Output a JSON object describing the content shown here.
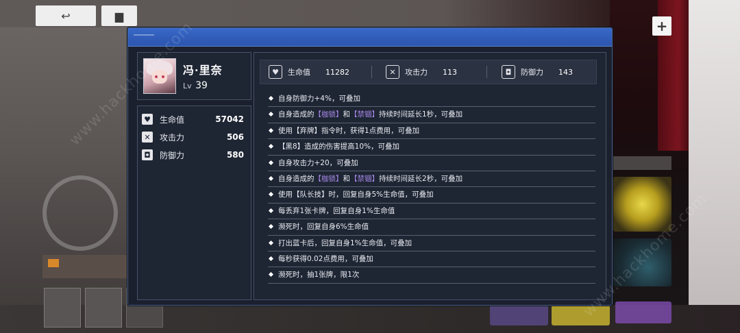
{
  "character": {
    "name": "冯·里奈",
    "level_prefix": "Lv",
    "level": "39"
  },
  "stats": [
    {
      "icon": "heart-icon",
      "glyph": "♥",
      "label": "生命值",
      "value": "57042"
    },
    {
      "icon": "sword-icon",
      "glyph": "✕",
      "label": "攻击力",
      "value": "506"
    },
    {
      "icon": "shield-icon",
      "glyph": "◘",
      "label": "防御力",
      "value": "580"
    }
  ],
  "summary": [
    {
      "icon": "heart-icon",
      "glyph": "♥",
      "label": "生命值",
      "value": "11282"
    },
    {
      "icon": "sword-icon",
      "glyph": "✕",
      "label": "攻击力",
      "value": "113"
    },
    {
      "icon": "shield-icon",
      "glyph": "◘",
      "label": "防御力",
      "value": "143"
    }
  ],
  "effects": [
    {
      "parts": [
        {
          "t": "自身防御力+4%，可叠加"
        }
      ]
    },
    {
      "parts": [
        {
          "t": "自身造成的"
        },
        {
          "t": "【枷锁】",
          "hl": true
        },
        {
          "t": "和"
        },
        {
          "t": "【禁锢】",
          "hl": true
        },
        {
          "t": "持续时间延长1秒，可叠加"
        }
      ]
    },
    {
      "parts": [
        {
          "t": "使用【弃牌】指令时，获得1点费用，可叠加"
        }
      ]
    },
    {
      "parts": [
        {
          "t": "【黑8】造成的伤害提高10%，可叠加"
        }
      ]
    },
    {
      "parts": [
        {
          "t": "自身攻击力+20，可叠加"
        }
      ]
    },
    {
      "parts": [
        {
          "t": "自身造成的"
        },
        {
          "t": "【枷锁】",
          "hl": true
        },
        {
          "t": "和"
        },
        {
          "t": "【禁锢】",
          "hl": true
        },
        {
          "t": "持续时间延长2秒，可叠加"
        }
      ]
    },
    {
      "parts": [
        {
          "t": "使用【队长技】时，回复自身5%生命值，可叠加"
        }
      ]
    },
    {
      "parts": [
        {
          "t": "每丢弃1张卡牌，回复自身1%生命值"
        }
      ]
    },
    {
      "parts": [
        {
          "t": "濒死时，回复自身6%生命值"
        }
      ]
    },
    {
      "parts": [
        {
          "t": "打出蓝卡后，回复自身1%生命值，可叠加"
        }
      ]
    },
    {
      "parts": [
        {
          "t": "每秒获得0.02点费用，可叠加"
        }
      ]
    },
    {
      "parts": [
        {
          "t": "濒死时，抽1张牌，限1次"
        }
      ]
    }
  ],
  "colors": {
    "header_blue": "#3868c8",
    "highlight_purple": "#a889ea",
    "panel_bg": "#1e2533"
  },
  "watermark": "www.hackhome.com"
}
